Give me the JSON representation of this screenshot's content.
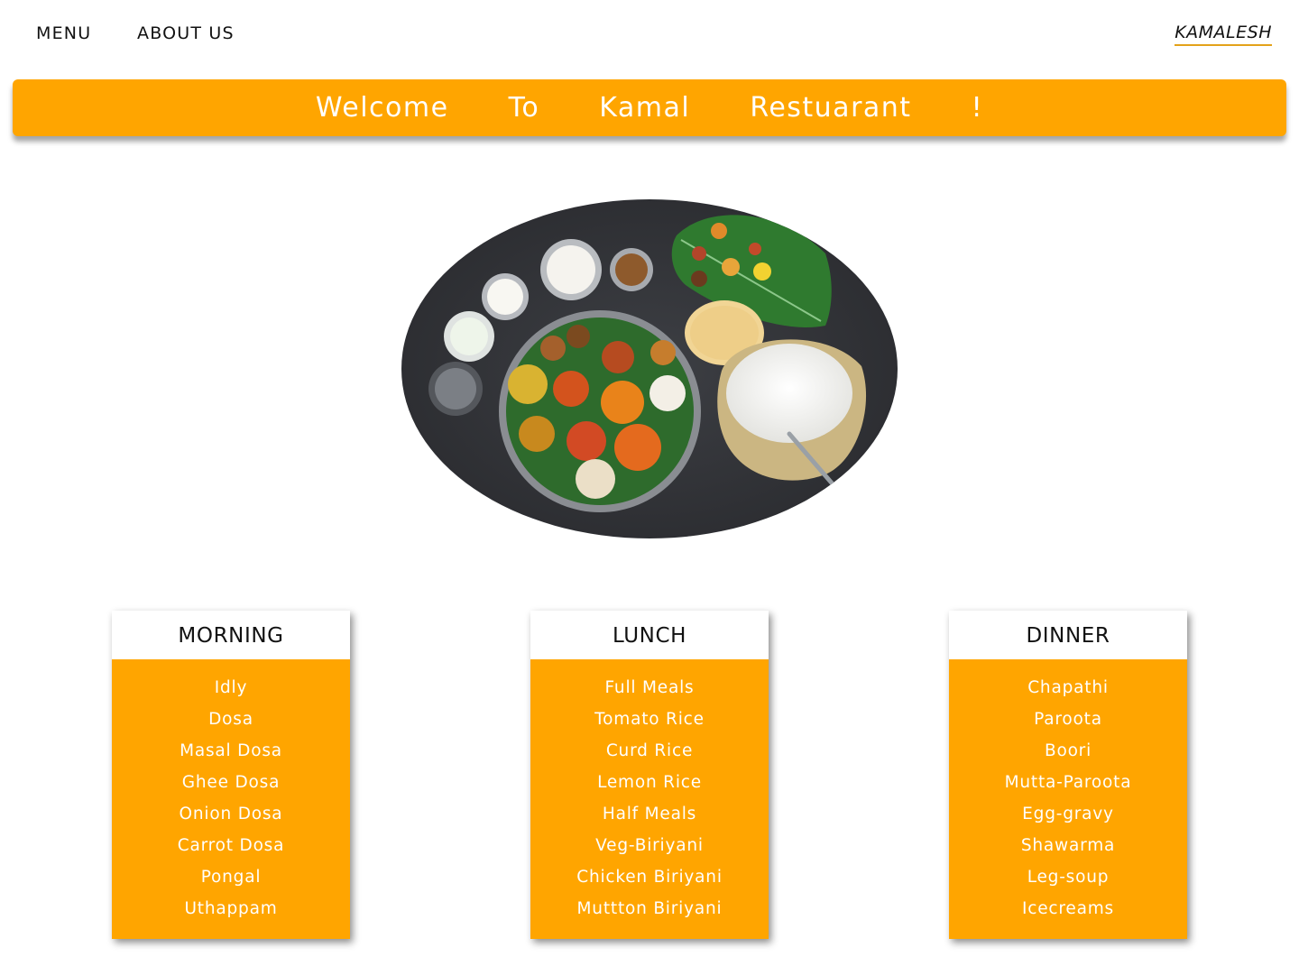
{
  "nav": {
    "menu_label": "MENU",
    "about_label": "ABOUT US",
    "brand": "KAMALESH"
  },
  "banner": {
    "text": "Welcome  To  Kamal  Restuarant  !"
  },
  "colors": {
    "accent": "#ffa500",
    "brand_underline": "#e3a21a",
    "text_dark": "#111111",
    "text_light": "#ffffff"
  },
  "hero": {
    "icon": "food-platter-image"
  },
  "menus": {
    "morning": {
      "title": "MORNING",
      "items": [
        "Idly",
        "Dosa",
        "Masal Dosa",
        "Ghee Dosa",
        "Onion Dosa",
        "Carrot Dosa",
        "Pongal",
        "Uthappam"
      ]
    },
    "lunch": {
      "title": "LUNCH",
      "items": [
        "Full Meals",
        "Tomato Rice",
        "Curd Rice",
        "Lemon Rice",
        "Half Meals",
        "Veg-Biriyani",
        "Chicken Biriyani",
        "Muttton Biriyani"
      ]
    },
    "dinner": {
      "title": "DINNER",
      "items": [
        "Chapathi",
        "Paroota",
        "Boori",
        "Mutta-Paroota",
        "Egg-gravy",
        "Shawarma",
        "Leg-soup",
        "Icecreams"
      ]
    }
  }
}
